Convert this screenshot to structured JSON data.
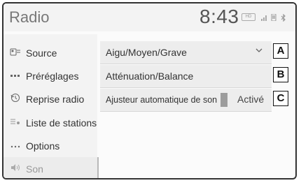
{
  "header": {
    "title": "Radio",
    "time": "8:43",
    "status_icons": {
      "hd_badge": "HD",
      "signal": "signal-icon",
      "bluetooth": "bluetooth-icon",
      "phone": "phone-icon",
      "battery": "battery-icon"
    }
  },
  "sidebar": {
    "items": [
      {
        "label": "Source",
        "icon": "source-icon"
      },
      {
        "label": "Préréglages",
        "icon": "presets-icon"
      },
      {
        "label": "Reprise radio",
        "icon": "radio-replay-icon"
      },
      {
        "label": "Liste de stations",
        "icon": "station-list-icon"
      },
      {
        "label": "Options",
        "icon": "options-icon"
      },
      {
        "label": "Son",
        "icon": "speaker-icon",
        "active": true
      }
    ]
  },
  "settings": {
    "rows": [
      {
        "label": "Aigu/Moyen/Grave",
        "callout": "A"
      },
      {
        "label": "Atténuation/Balance",
        "callout": "B"
      },
      {
        "label": "Ajusteur automatique de son",
        "value": "Activé",
        "callout": "C"
      }
    ]
  }
}
